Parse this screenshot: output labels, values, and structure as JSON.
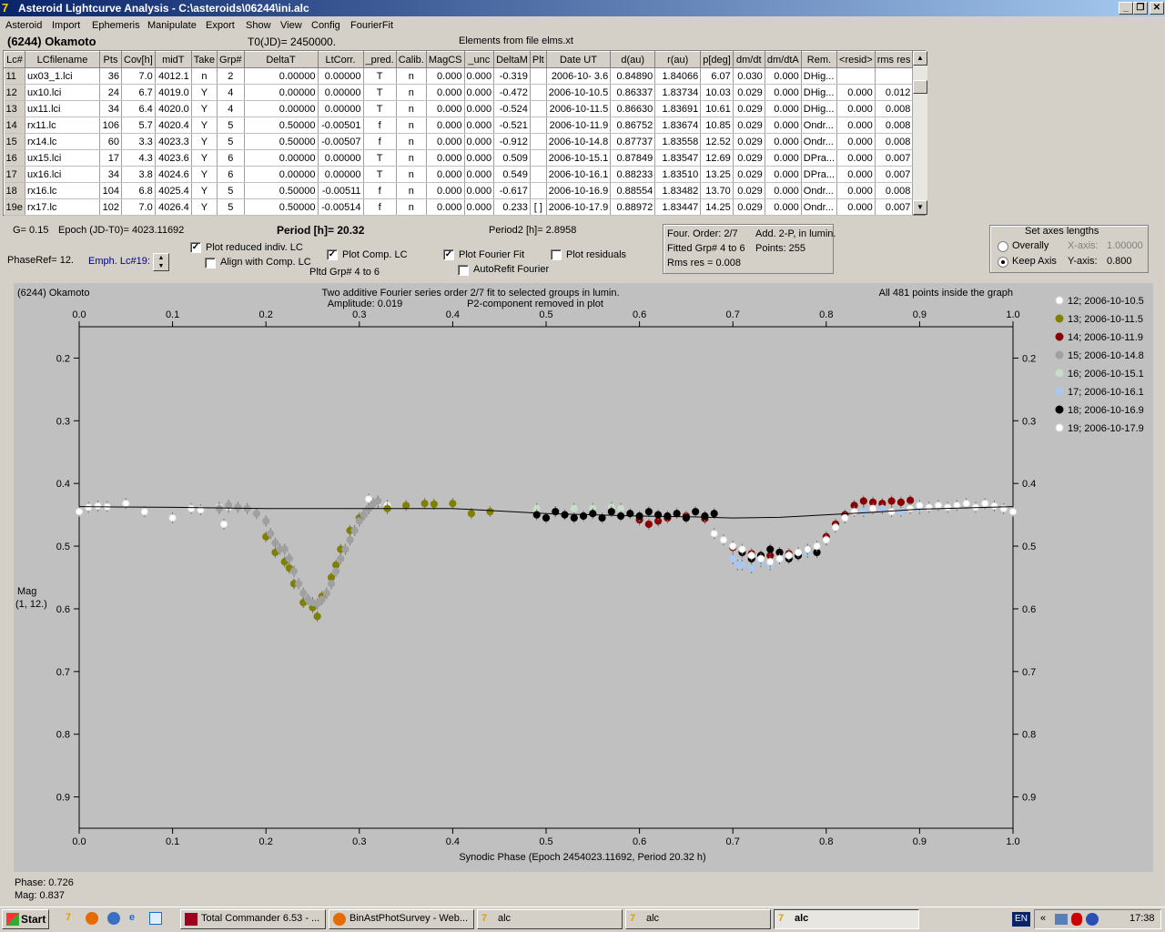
{
  "window": {
    "title": "Asteroid Lightcurve Analysis - C:\\asteroids\\06244\\ini.alc",
    "app_icon": "7",
    "min_label": "_",
    "max_label": "❐",
    "close_label": "✕"
  },
  "menu": [
    "Asteroid",
    "Import",
    "Ephemeris",
    "Manipulate",
    "Export",
    "Show",
    "View",
    "Config",
    "FourierFit"
  ],
  "header": {
    "asteroid": "(6244) Okamoto",
    "t0": "T0(JD)= 2450000.",
    "elements": "Elements from file elms.xt"
  },
  "table": {
    "columns": [
      "Lc#",
      "LCfilename",
      "Pts",
      "Cov[h]",
      "midT",
      "Take",
      "Grp#",
      "DeltaT",
      "LtCorr.",
      "_pred.",
      "Calib.",
      "MagCS",
      "_unc",
      "DeltaM",
      "Plt",
      "Date UT",
      "d(au)",
      "r(au)",
      "p[deg]",
      "dm/dt",
      "dm/dtA",
      "Rem.",
      "<resid>",
      "rms res"
    ],
    "rows": [
      [
        "11",
        "ux03_1.lci",
        "36",
        "7.0",
        "4012.1",
        "n",
        "2",
        "0.00000",
        "0.00000",
        "T",
        "n",
        "0.000",
        "0.000",
        "-0.319",
        "",
        "2006-10- 3.6",
        "0.84890",
        "1.84066",
        "6.07",
        "0.030",
        "0.000",
        "DHig...",
        "",
        ""
      ],
      [
        "12",
        "ux10.lci",
        "24",
        "6.7",
        "4019.0",
        "Y",
        "4",
        "0.00000",
        "0.00000",
        "T",
        "n",
        "0.000",
        "0.000",
        "-0.472",
        "",
        "2006-10-10.5",
        "0.86337",
        "1.83734",
        "10.03",
        "0.029",
        "0.000",
        "DHig...",
        "0.000",
        "0.012"
      ],
      [
        "13",
        "ux11.lci",
        "34",
        "6.4",
        "4020.0",
        "Y",
        "4",
        "0.00000",
        "0.00000",
        "T",
        "n",
        "0.000",
        "0.000",
        "-0.524",
        "",
        "2006-10-11.5",
        "0.86630",
        "1.83691",
        "10.61",
        "0.029",
        "0.000",
        "DHig...",
        "0.000",
        "0.008"
      ],
      [
        "14",
        "rx11.lc",
        "106",
        "5.7",
        "4020.4",
        "Y",
        "5",
        "0.50000",
        "-0.00501",
        "f",
        "n",
        "0.000",
        "0.000",
        "-0.521",
        "",
        "2006-10-11.9",
        "0.86752",
        "1.83674",
        "10.85",
        "0.029",
        "0.000",
        "Ondr...",
        "0.000",
        "0.008"
      ],
      [
        "15",
        "rx14.lc",
        "60",
        "3.3",
        "4023.3",
        "Y",
        "5",
        "0.50000",
        "-0.00507",
        "f",
        "n",
        "0.000",
        "0.000",
        "-0.912",
        "",
        "2006-10-14.8",
        "0.87737",
        "1.83558",
        "12.52",
        "0.029",
        "0.000",
        "Ondr...",
        "0.000",
        "0.008"
      ],
      [
        "16",
        "ux15.lci",
        "17",
        "4.3",
        "4023.6",
        "Y",
        "6",
        "0.00000",
        "0.00000",
        "T",
        "n",
        "0.000",
        "0.000",
        "0.509",
        "",
        "2006-10-15.1",
        "0.87849",
        "1.83547",
        "12.69",
        "0.029",
        "0.000",
        "DPra...",
        "0.000",
        "0.007"
      ],
      [
        "17",
        "ux16.lci",
        "34",
        "3.8",
        "4024.6",
        "Y",
        "6",
        "0.00000",
        "0.00000",
        "T",
        "n",
        "0.000",
        "0.000",
        "0.549",
        "",
        "2006-10-16.1",
        "0.88233",
        "1.83510",
        "13.25",
        "0.029",
        "0.000",
        "DPra...",
        "0.000",
        "0.007"
      ],
      [
        "18",
        "rx16.lc",
        "104",
        "6.8",
        "4025.4",
        "Y",
        "5",
        "0.50000",
        "-0.00511",
        "f",
        "n",
        "0.000",
        "0.000",
        "-0.617",
        "",
        "2006-10-16.9",
        "0.88554",
        "1.83482",
        "13.70",
        "0.029",
        "0.000",
        "Ondr...",
        "0.000",
        "0.008"
      ],
      [
        "19e",
        "rx17.lc",
        "102",
        "7.0",
        "4026.4",
        "Y",
        "5",
        "0.50000",
        "-0.00514",
        "f",
        "n",
        "0.000",
        "0.000",
        "0.233",
        "[ ]",
        "2006-10-17.9",
        "0.88972",
        "1.83447",
        "14.25",
        "0.029",
        "0.000",
        "Ondr...",
        "0.000",
        "0.007"
      ]
    ]
  },
  "controls": {
    "g": "G= 0.15",
    "epoch": "Epoch (JD-T0)= 4023.11692",
    "period": "Period [h]= 20.32",
    "period2": "Period2 [h]= 2.8958",
    "phaseref": "PhaseRef= 12.",
    "emph": "Emph. Lc#19:",
    "plot_reduced": {
      "label": "Plot reduced indiv. LC",
      "checked": true
    },
    "align_comp": {
      "label": "Align with Comp. LC",
      "checked": false
    },
    "plot_comp": {
      "label": "Plot Comp. LC",
      "checked": true
    },
    "pltd_grp": "Pltd Grp#  4   to   6",
    "plot_fourier": {
      "label": "Plot Fourier Fit",
      "checked": true
    },
    "autorefit": {
      "label": "AutoRefit Fourier",
      "checked": false
    },
    "plot_residuals": {
      "label": "Plot residuals",
      "checked": false
    },
    "four_order": "Four. Order:  2/7",
    "add2p": "Add. 2-P, in lumin.",
    "fitted_grp": "Fitted Grp# 4 to 6",
    "points": "Points: 255",
    "rms": "Rms res      = 0.008",
    "axes_title": "Set axes lengths",
    "overally": "Overally",
    "keep_axis": "Keep Axis",
    "xaxis_label": "X-axis:",
    "xaxis_val": "1.00000",
    "yaxis_label": "Y-axis:",
    "yaxis_val": "0.800",
    "check_glyph": "✓"
  },
  "graph": {
    "title_left": "(6244) Okamoto",
    "title_center1": "Two additive Fourier series order 2/7 fit to selected groups in lumin.",
    "title_center2": "Amplitude: 0.019",
    "title_center3": "P2-component removed in plot",
    "title_right": "All 481 points inside the graph",
    "ylabel1": "Mag",
    "ylabel2": "(1, 12.)",
    "xlabel": "Synodic Phase (Epoch 2454023.11692, Period 20.32 h)",
    "phase_readout": "Phase:  0.726",
    "mag_readout": "Mag:    0.837",
    "background_color": "#c0c0c0"
  },
  "chart_data": {
    "type": "scatter",
    "xlim": [
      0.0,
      1.0
    ],
    "ylim": [
      0.15,
      0.95
    ],
    "y_inverted": true,
    "xticks": [
      "0.0",
      "0.1",
      "0.2",
      "0.3",
      "0.4",
      "0.5",
      "0.6",
      "0.7",
      "0.8",
      "0.9",
      "1.0"
    ],
    "yticks": [
      "0.2",
      "0.3",
      "0.4",
      "0.5",
      "0.6",
      "0.7",
      "0.8",
      "0.9"
    ],
    "legend_placement": "right",
    "series": [
      {
        "name": "12; 2006-10-10.5",
        "color": "#ffffff",
        "x": [
          0.0,
          0.01,
          0.02,
          0.03,
          0.05,
          0.07,
          0.1,
          0.12,
          0.13,
          0.15,
          0.155,
          0.16,
          0.31,
          0.32,
          0.33
        ],
        "y": [
          0.445,
          0.438,
          0.436,
          0.437,
          0.432,
          0.445,
          0.455,
          0.44,
          0.442,
          0.438,
          0.465,
          0.438,
          0.425,
          0.43,
          0.435
        ]
      },
      {
        "name": "13; 2006-10-11.5",
        "color": "#808000",
        "x": [
          0.2,
          0.21,
          0.22,
          0.225,
          0.23,
          0.24,
          0.25,
          0.255,
          0.26,
          0.27,
          0.275,
          0.28,
          0.29,
          0.3,
          0.31,
          0.33,
          0.35,
          0.37,
          0.38,
          0.4,
          0.42,
          0.44
        ],
        "y": [
          0.485,
          0.51,
          0.525,
          0.535,
          0.56,
          0.59,
          0.598,
          0.612,
          0.58,
          0.55,
          0.53,
          0.505,
          0.475,
          0.455,
          0.44,
          0.44,
          0.435,
          0.432,
          0.433,
          0.432,
          0.448,
          0.445
        ]
      },
      {
        "name": "14; 2006-10-11.9",
        "color": "#8b0000",
        "x": [
          0.6,
          0.61,
          0.62,
          0.63,
          0.65,
          0.67,
          0.7,
          0.72,
          0.74,
          0.76,
          0.78,
          0.8,
          0.81,
          0.82,
          0.83,
          0.84,
          0.85,
          0.86,
          0.87,
          0.88,
          0.89
        ],
        "y": [
          0.458,
          0.465,
          0.46,
          0.455,
          0.452,
          0.456,
          0.502,
          0.512,
          0.515,
          0.512,
          0.505,
          0.485,
          0.465,
          0.45,
          0.435,
          0.428,
          0.43,
          0.432,
          0.428,
          0.43,
          0.427
        ]
      },
      {
        "name": "15; 2006-10-14.8",
        "color": "#a0a0a0",
        "x": [
          0.15,
          0.16,
          0.17,
          0.18,
          0.19,
          0.2,
          0.205,
          0.21,
          0.215,
          0.22,
          0.225,
          0.23,
          0.235,
          0.24,
          0.245,
          0.25,
          0.255,
          0.26,
          0.265,
          0.27,
          0.275,
          0.28,
          0.285,
          0.29,
          0.295,
          0.3,
          0.305,
          0.31,
          0.315,
          0.32
        ],
        "y": [
          0.44,
          0.435,
          0.438,
          0.44,
          0.448,
          0.46,
          0.48,
          0.495,
          0.505,
          0.505,
          0.52,
          0.54,
          0.56,
          0.575,
          0.585,
          0.59,
          0.592,
          0.585,
          0.575,
          0.56,
          0.54,
          0.52,
          0.505,
          0.49,
          0.475,
          0.46,
          0.45,
          0.44,
          0.432,
          0.428
        ]
      },
      {
        "name": "16; 2006-10-15.1",
        "color": "#c8dcc8",
        "x": [
          0.49,
          0.51,
          0.53,
          0.55,
          0.57,
          0.58
        ],
        "y": [
          0.44,
          0.445,
          0.44,
          0.44,
          0.438,
          0.44
        ]
      },
      {
        "name": "17; 2006-10-16.1",
        "color": "#a8c8f0",
        "x": [
          0.7,
          0.705,
          0.71,
          0.72,
          0.73,
          0.74,
          0.75,
          0.76,
          0.78,
          0.8,
          0.82,
          0.84,
          0.86,
          0.88,
          0.9
        ],
        "y": [
          0.52,
          0.53,
          0.53,
          0.535,
          0.525,
          0.53,
          0.52,
          0.515,
          0.51,
          0.49,
          0.455,
          0.445,
          0.44,
          0.445,
          0.44
        ]
      },
      {
        "name": "18; 2006-10-16.9",
        "color": "#000000",
        "x": [
          0.49,
          0.5,
          0.51,
          0.52,
          0.53,
          0.54,
          0.55,
          0.56,
          0.57,
          0.58,
          0.59,
          0.6,
          0.61,
          0.62,
          0.63,
          0.64,
          0.65,
          0.66,
          0.67,
          0.68,
          0.71,
          0.72,
          0.73,
          0.74,
          0.75,
          0.76,
          0.77,
          0.78,
          0.79
        ],
        "y": [
          0.45,
          0.455,
          0.445,
          0.45,
          0.455,
          0.452,
          0.448,
          0.455,
          0.445,
          0.452,
          0.448,
          0.452,
          0.445,
          0.45,
          0.452,
          0.448,
          0.455,
          0.445,
          0.452,
          0.448,
          0.51,
          0.52,
          0.515,
          0.505,
          0.51,
          0.52,
          0.515,
          0.505,
          0.51
        ]
      },
      {
        "name": "19; 2006-10-17.9",
        "color": "#ffffff",
        "x": [
          0.68,
          0.69,
          0.7,
          0.71,
          0.72,
          0.73,
          0.74,
          0.75,
          0.76,
          0.77,
          0.78,
          0.79,
          0.8,
          0.81,
          0.82,
          0.83,
          0.85,
          0.87,
          0.89,
          0.9,
          0.91,
          0.92,
          0.93,
          0.94,
          0.95,
          0.96,
          0.97,
          0.98,
          0.99,
          1.0
        ],
        "y": [
          0.48,
          0.49,
          0.5,
          0.505,
          0.515,
          0.52,
          0.525,
          0.52,
          0.515,
          0.51,
          0.505,
          0.5,
          0.49,
          0.47,
          0.455,
          0.445,
          0.44,
          0.445,
          0.44,
          0.435,
          0.438,
          0.435,
          0.438,
          0.435,
          0.432,
          0.438,
          0.432,
          0.436,
          0.44,
          0.445
        ]
      }
    ],
    "fit_line": {
      "x": [
        0.0,
        0.1,
        0.2,
        0.3,
        0.4,
        0.5,
        0.6,
        0.65,
        0.7,
        0.75,
        0.8,
        0.85,
        0.9,
        1.0
      ],
      "y": [
        0.437,
        0.438,
        0.44,
        0.44,
        0.44,
        0.448,
        0.452,
        0.453,
        0.455,
        0.454,
        0.45,
        0.446,
        0.441,
        0.437
      ]
    }
  },
  "taskbar": {
    "start": "Start",
    "buttons": [
      "Total Commander 6.53 - ...",
      "BinAstPhotSurvey - Web...",
      "alc",
      "alc",
      "alc"
    ],
    "lang": "EN",
    "clock": "17:38"
  }
}
